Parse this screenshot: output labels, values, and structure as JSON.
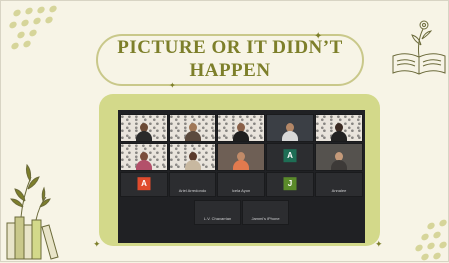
{
  "slide": {
    "title_line1": "PICTURE OR IT DIDN’T",
    "title_line2": "HAPPEN",
    "accent_color": "#7d7f2a",
    "frame_color": "#d3d98a"
  },
  "meeting": {
    "participants": [
      {
        "name": "",
        "avatar": "",
        "avatar_color": ""
      },
      {
        "name": "",
        "avatar": "",
        "avatar_color": ""
      },
      {
        "name": "",
        "avatar": "",
        "avatar_color": ""
      },
      {
        "name": "",
        "avatar": "",
        "avatar_color": ""
      },
      {
        "name": "",
        "avatar": "",
        "avatar_color": ""
      },
      {
        "name": "",
        "avatar": "",
        "avatar_color": ""
      },
      {
        "name": "",
        "avatar": "",
        "avatar_color": ""
      },
      {
        "name": "",
        "avatar": "",
        "avatar_color": ""
      },
      {
        "name": "",
        "avatar": "A",
        "avatar_color": "#1e6e55"
      },
      {
        "name": "",
        "avatar": "",
        "avatar_color": ""
      },
      {
        "name": "",
        "avatar": "A",
        "avatar_color": "#e04b2d"
      },
      {
        "name": "Ariel Arredondo",
        "avatar": "",
        "avatar_color": ""
      },
      {
        "name": "Icela Ayon",
        "avatar": "",
        "avatar_color": ""
      },
      {
        "name": "",
        "avatar": "J",
        "avatar_color": "#5a8a2a"
      },
      {
        "name": "Annalee",
        "avatar": "",
        "avatar_color": ""
      },
      {
        "name": "L.V. Chavarrian",
        "avatar": "",
        "avatar_color": ""
      },
      {
        "name": "Jammi's iPhone",
        "avatar": "",
        "avatar_color": ""
      }
    ]
  },
  "icons": [
    "leaf-dots-icon",
    "open-book-flower-icon",
    "book-stack-plant-icon",
    "sparkle-icon"
  ]
}
